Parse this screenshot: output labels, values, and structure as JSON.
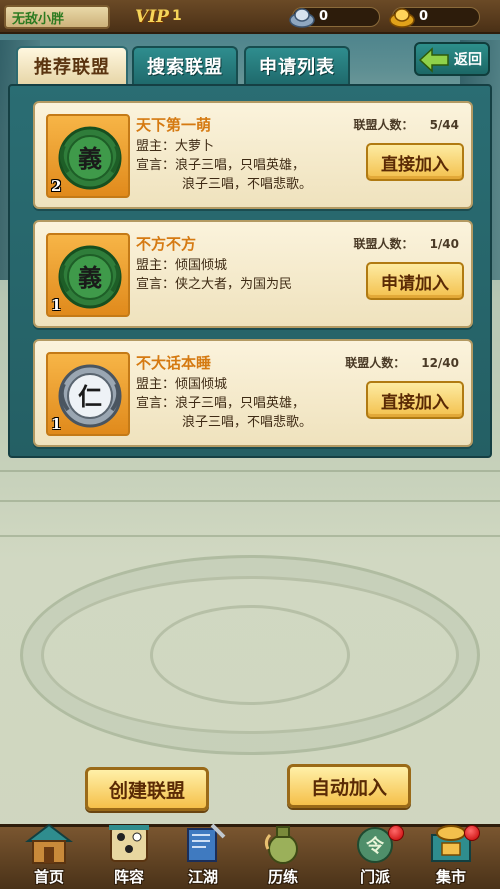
{
  "player": {
    "name": "无敌小胖",
    "vip_label": "VIP",
    "vip_level": "1"
  },
  "resources": {
    "silver": "0",
    "gold": "0"
  },
  "tabs": [
    {
      "label": "推荐联盟",
      "active": true
    },
    {
      "label": "搜索联盟",
      "active": false
    },
    {
      "label": "申请列表",
      "active": false
    }
  ],
  "back_label": "返回",
  "members_label": "联盟人数：",
  "leader_label": "盟主：",
  "declaration_label": "宣言：",
  "alliances": [
    {
      "name": "天下第一萌",
      "members": "5/44",
      "leader": "大萝卜",
      "declaration_line1": "浪子三唱，只唱英雄，",
      "declaration_line2": "浪子三唱，不唱悲歌。",
      "level": "2",
      "emblem_char": "義",
      "button_label": "直接加入"
    },
    {
      "name": "不方不方",
      "members": "1/40",
      "leader": "倾国倾城",
      "declaration_line1": "侠之大者，为国为民",
      "declaration_line2": "",
      "level": "1",
      "emblem_char": "義",
      "button_label": "申请加入"
    },
    {
      "name": "不大话本睡",
      "members": "12/40",
      "leader": "倾国倾城",
      "declaration_line1": "浪子三唱，只唱英雄，",
      "declaration_line2": "浪子三唱，不唱悲歌。",
      "level": "1",
      "emblem_char": "仁",
      "button_label": "直接加入"
    }
  ],
  "actions": {
    "create": "创建联盟",
    "auto_join": "自动加入"
  },
  "nav": [
    {
      "label": "首页",
      "icon": "home-icon",
      "badge": false
    },
    {
      "label": "阵容",
      "icon": "lineup-icon",
      "badge": false
    },
    {
      "label": "江湖",
      "icon": "jianghu-icon",
      "badge": false
    },
    {
      "label": "历练",
      "icon": "training-icon",
      "badge": false
    },
    {
      "label": "门派",
      "icon": "sect-icon",
      "badge": true
    },
    {
      "label": "集市",
      "icon": "market-icon",
      "badge": true
    }
  ],
  "colors": {
    "tab_active_bg": "#f3e6bf",
    "tab_inactive_bg": "#2f8d8e",
    "alliance_name": "#d57a12",
    "button_gold": "#f3c04c",
    "badge_red": "#c40000"
  }
}
